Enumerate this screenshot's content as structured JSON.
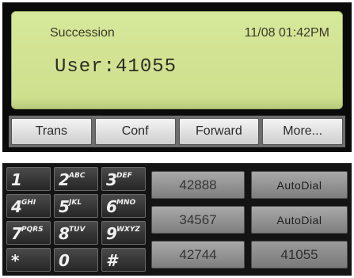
{
  "display": {
    "top_label": "Succession",
    "datetime": "11/08 01:42PM",
    "main_line": "User:41055"
  },
  "softkeys": [
    "Trans",
    "Conf",
    "Forward",
    "More..."
  ],
  "keypad": [
    {
      "digit": "1",
      "letters": ""
    },
    {
      "digit": "2",
      "letters": "ABC"
    },
    {
      "digit": "3",
      "letters": "DEF"
    },
    {
      "digit": "4",
      "letters": "GHI"
    },
    {
      "digit": "5",
      "letters": "JKL"
    },
    {
      "digit": "6",
      "letters": "MNO"
    },
    {
      "digit": "7",
      "letters": "PQRS"
    },
    {
      "digit": "8",
      "letters": "TUV"
    },
    {
      "digit": "9",
      "letters": "WXYZ"
    },
    {
      "digit": "*",
      "letters": ""
    },
    {
      "digit": "0",
      "letters": ""
    },
    {
      "digit": "#",
      "letters": ""
    }
  ],
  "speed_dials": [
    "42888",
    "34567",
    "42744"
  ],
  "function_keys": [
    "AutoDial",
    "AutoDial",
    "41055"
  ]
}
